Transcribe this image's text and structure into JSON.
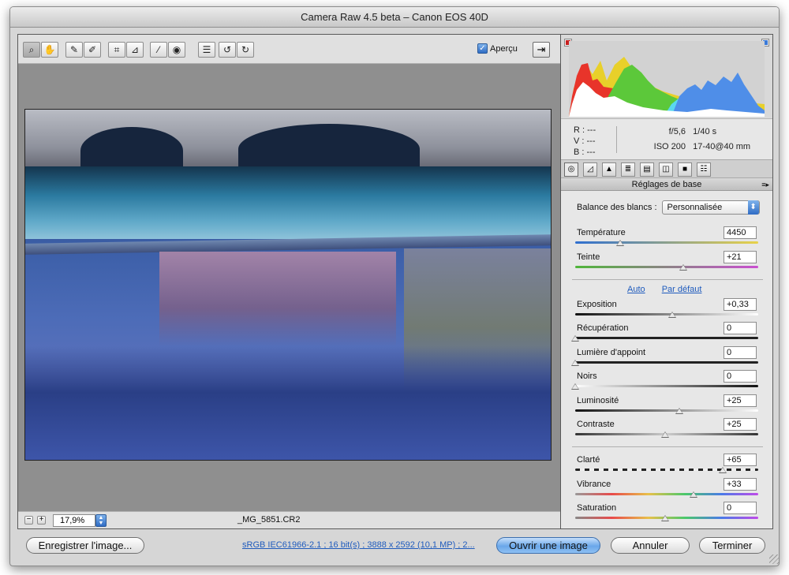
{
  "window": {
    "title": "Camera Raw 4.5 beta  –  Canon EOS 40D"
  },
  "toolbar": {
    "tools": [
      {
        "name": "zoom-tool",
        "icon": "magnifier-icon",
        "glyph": "⌕"
      },
      {
        "name": "hand-tool",
        "icon": "hand-icon",
        "glyph": "✋"
      },
      {
        "name": "white-balance-tool",
        "icon": "eyedropper-icon",
        "glyph": "✎"
      },
      {
        "name": "color-sampler-tool",
        "icon": "eyedropper-plus-icon",
        "glyph": "✐"
      },
      {
        "name": "crop-tool",
        "icon": "crop-icon",
        "glyph": "⌗"
      },
      {
        "name": "straighten-tool",
        "icon": "level-icon",
        "glyph": "⊿"
      },
      {
        "name": "retouch-tool",
        "icon": "brush-icon",
        "glyph": "⁄"
      },
      {
        "name": "red-eye-tool",
        "icon": "eye-icon",
        "glyph": "◉"
      },
      {
        "name": "preferences-tool",
        "icon": "list-icon",
        "glyph": "☰"
      },
      {
        "name": "rotate-left-tool",
        "icon": "rotate-ccw-icon",
        "glyph": "↺"
      },
      {
        "name": "rotate-right-tool",
        "icon": "rotate-cw-icon",
        "glyph": "↻"
      }
    ],
    "preview_label": "Aperçu",
    "preview_checked": true,
    "fullscreen_glyph": "⇥"
  },
  "statusbar": {
    "zoom_minus": "−",
    "zoom_plus": "+",
    "zoom_value": "17,9%",
    "filename": "_MG_5851.CR2"
  },
  "histogram": {
    "colors": {
      "red": "#e8342a",
      "green": "#5cc83a",
      "blue": "#4f8ee8",
      "yellow": "#e8d02a",
      "cyan": "#5ad8f0",
      "white": "#ffffff"
    }
  },
  "readout": {
    "r_label": "R :",
    "r_value": "---",
    "v_label": "V :",
    "v_value": "---",
    "b_label": "B :",
    "b_value": "---",
    "aperture": "f/5,6",
    "shutter": "1/40 s",
    "iso": "ISO 200",
    "lens": "17-40@40 mm"
  },
  "panel": {
    "title": "Réglages de base",
    "tabs": [
      {
        "name": "tab-basic",
        "icon": "aperture-icon",
        "glyph": "◎"
      },
      {
        "name": "tab-tone-curve",
        "icon": "curve-icon",
        "glyph": "◿"
      },
      {
        "name": "tab-detail",
        "icon": "mountain-icon",
        "glyph": "▲"
      },
      {
        "name": "tab-hsl",
        "icon": "hsl-icon",
        "glyph": "≣"
      },
      {
        "name": "tab-split-toning",
        "icon": "split-icon",
        "glyph": "▤"
      },
      {
        "name": "tab-lens",
        "icon": "lens-icon",
        "glyph": "◫"
      },
      {
        "name": "tab-camera-calibration",
        "icon": "camera-icon",
        "glyph": "■"
      },
      {
        "name": "tab-presets",
        "icon": "presets-icon",
        "glyph": "☷"
      }
    ],
    "white_balance_label": "Balance des blancs :",
    "white_balance_value": "Personnalisée",
    "auto_link": "Auto",
    "default_link": "Par défaut"
  },
  "sliders": [
    {
      "name": "temperature",
      "label": "Température",
      "value": "4450",
      "position": 0.25,
      "track": "linear-gradient(90deg,#2f6fd0,#e8d24a)"
    },
    {
      "name": "tint",
      "label": "Teinte",
      "value": "+21",
      "position": 0.6,
      "track": "linear-gradient(90deg,#4fb63a,#c94fd0)"
    },
    {
      "name": "exposure",
      "label": "Exposition",
      "value": "+0,33",
      "position": 0.54,
      "track": "linear-gradient(90deg,#111,#fff)"
    },
    {
      "name": "recovery",
      "label": "Récupération",
      "value": "0",
      "position": 0.0,
      "track": "linear-gradient(90deg,#222,#222)"
    },
    {
      "name": "fill-light",
      "label": "Lumière d'appoint",
      "value": "0",
      "position": 0.0,
      "track": "linear-gradient(90deg,#222,#222)"
    },
    {
      "name": "blacks",
      "label": "Noirs",
      "value": "0",
      "position": 0.0,
      "track": "linear-gradient(90deg,#fff,#111)"
    },
    {
      "name": "brightness",
      "label": "Luminosité",
      "value": "+25",
      "position": 0.58,
      "track": "linear-gradient(90deg,#111,#fff)"
    },
    {
      "name": "contrast",
      "label": "Contraste",
      "value": "+25",
      "position": 0.5,
      "track": "linear-gradient(90deg,#333,#ccc,#333)"
    },
    {
      "name": "clarity",
      "label": "Clarté",
      "value": "+65",
      "position": 0.82,
      "track": "repeating-linear-gradient(90deg,#222 0 6px,#eee 6px 12px)"
    },
    {
      "name": "vibrance",
      "label": "Vibrance",
      "value": "+33",
      "position": 0.66,
      "track": "linear-gradient(90deg,#999,#e84a4a,#e8c04a,#4ac86a,#4a7ae8,#c04ae8)"
    },
    {
      "name": "saturation",
      "label": "Saturation",
      "value": "0",
      "position": 0.5,
      "track": "linear-gradient(90deg,#888,#e84a4a,#e8c04a,#4ac86a,#4a7ae8,#c04ae8)"
    }
  ],
  "footer": {
    "save_button": "Enregistrer l'image...",
    "info_link": "sRGB IEC61966-2.1 ; 16 bit(s) ; 3888 x 2592 (10,1 MP) ; 2...",
    "open_button": "Ouvrir une image",
    "cancel_button": "Annuler",
    "done_button": "Terminer"
  }
}
